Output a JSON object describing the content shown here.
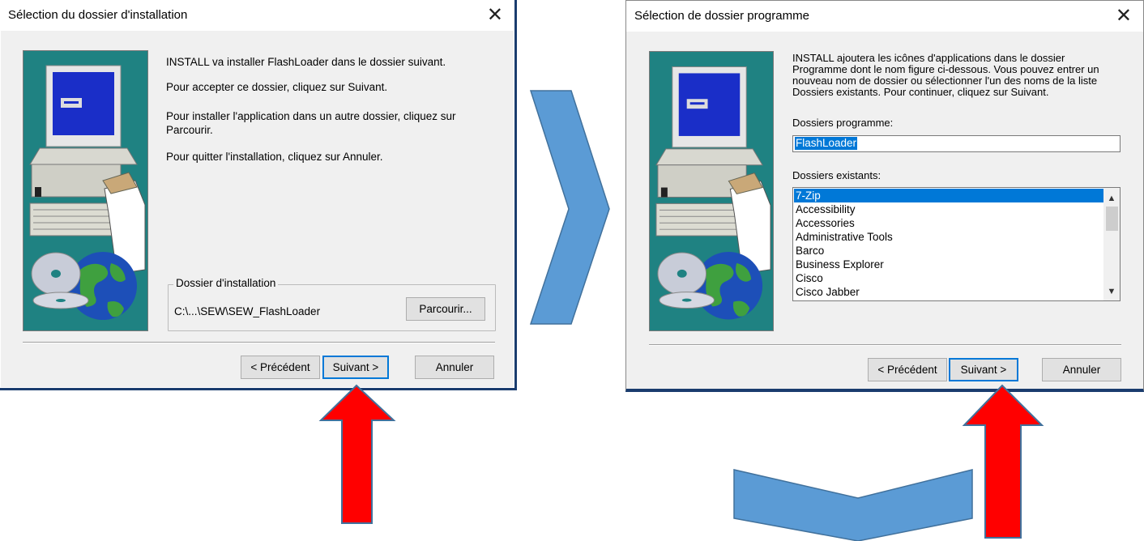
{
  "dialog1": {
    "title": "Sélection du dossier d'installation",
    "close": "✕",
    "line1": "INSTALL va installer FlashLoader dans le dossier suivant.",
    "line2": "Pour accepter ce dossier, cliquez sur Suivant.",
    "line3a": "Pour installer l'application dans un autre dossier, cliquez sur",
    "line3b": "Parcourir.",
    "line4": "Pour quitter l'installation, cliquez sur Annuler.",
    "group_label": "Dossier d'installation",
    "path": "C:\\...\\SEW\\SEW_FlashLoader",
    "browse_label": "Parcourir...",
    "back_label": "< Précédent",
    "next_label": "Suivant >",
    "cancel_label": "Annuler"
  },
  "dialog2": {
    "title": "Sélection de dossier programme",
    "close": "✕",
    "desc1": "INSTALL ajoutera les icônes d'applications dans le dossier",
    "desc2": "Programme dont le nom figure ci-dessous. Vous pouvez entrer un",
    "desc3": "nouveau nom de dossier ou sélectionner l'un des noms de la liste",
    "desc4": "Dossiers existants. Pour continuer, cliquez sur Suivant.",
    "program_label": "Dossiers programme:",
    "program_value": "FlashLoader",
    "existing_label": "Dossiers existants:",
    "folders": [
      "7-Zip",
      "Accessibility",
      "Accessories",
      "Administrative Tools",
      "Barco",
      "Business Explorer",
      "Cisco",
      "Cisco Jabber"
    ],
    "back_label": "< Précédent",
    "next_label": "Suivant >",
    "cancel_label": "Annuler"
  },
  "colors": {
    "arrow_blue": "#5b9bd5",
    "arrow_red": "#ff0000",
    "panel_teal": "#1f8282",
    "selection": "#0078d7"
  },
  "icons": [
    "close-icon",
    "computer-illustration",
    "globe-illustration",
    "cd-illustration",
    "chevron-up-icon",
    "chevron-down-icon"
  ]
}
